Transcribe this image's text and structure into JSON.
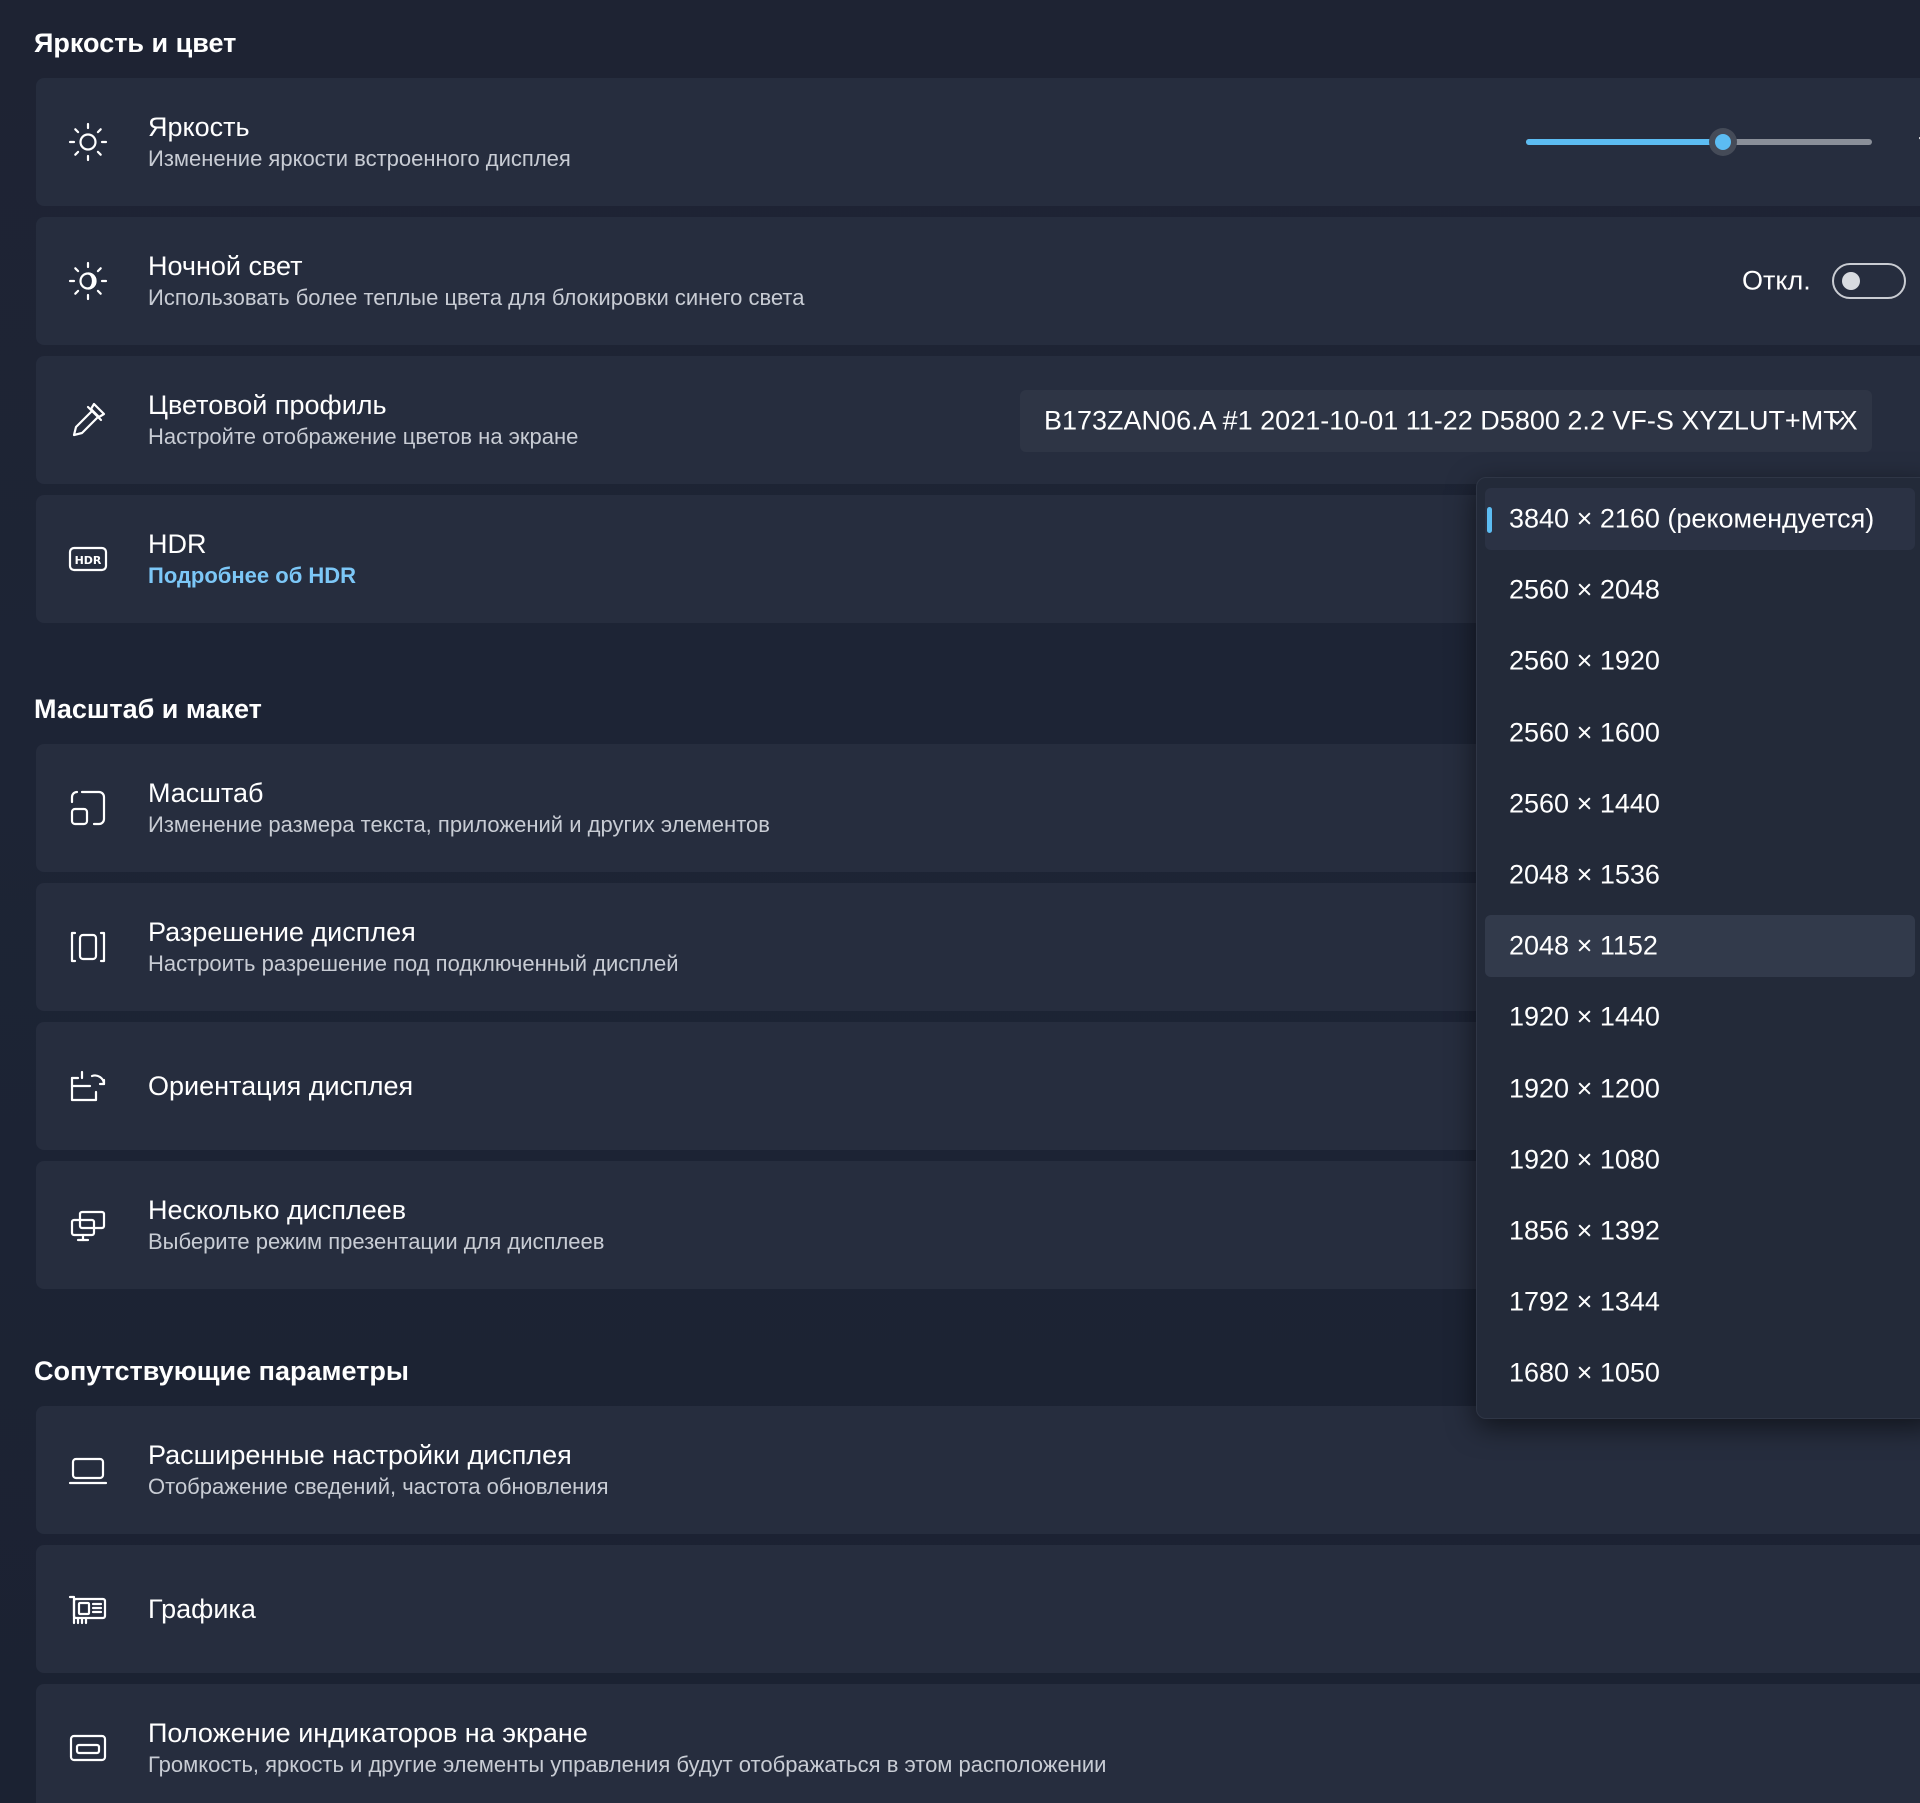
{
  "sections": {
    "brightness_color": "Яркость и цвет",
    "scale_layout": "Масштаб и макет",
    "related": "Сопутствующие параметры"
  },
  "brightness": {
    "title": "Яркость",
    "subtitle": "Изменение яркости встроенного дисплея",
    "value_fraction": 0.57,
    "icon": "sun-icon"
  },
  "night_light": {
    "title": "Ночной свет",
    "subtitle": "Использовать более теплые цвета для блокировки синего света",
    "state_label": "Откл.",
    "icon": "night-light-icon"
  },
  "color_profile": {
    "title": "Цветовой профиль",
    "subtitle": "Настройте отображение цветов на экране",
    "selected": "B173ZAN06.A #1 2021-10-01 11-22 D5800 2.2 VF-S XYZLUT+MTX",
    "icon": "eyedropper-icon"
  },
  "hdr": {
    "title": "HDR",
    "link": "Подробнее об HDR",
    "icon": "hdr-icon"
  },
  "scale": {
    "title": "Масштаб",
    "subtitle": "Изменение размера текста, приложений и других элементов",
    "icon": "scale-icon"
  },
  "resolution": {
    "title": "Разрешение дисплея",
    "subtitle": "Настроить разрешение под подключенный дисплей",
    "icon": "resolution-icon"
  },
  "orientation": {
    "title": "Ориентация дисплея",
    "icon": "orientation-icon"
  },
  "multi_display": {
    "title": "Несколько дисплеев",
    "subtitle": "Выберите режим презентации для дисплеев",
    "icon": "multi-display-icon"
  },
  "advanced_display": {
    "title": "Расширенные настройки дисплея",
    "subtitle": "Отображение сведений, частота обновления",
    "icon": "monitor-icon"
  },
  "graphics": {
    "title": "Графика",
    "icon": "graphics-card-icon"
  },
  "indicators": {
    "title": "Положение индикаторов на экране",
    "subtitle": "Громкость, яркость и другие элементы управления будут отображаться в этом расположении",
    "icon": "indicator-position-icon"
  },
  "resolution_options": [
    "3840 × 2160 (рекомендуется)",
    "2560 × 2048",
    "2560 × 1920",
    "2560 × 1600",
    "2560 × 1440",
    "2048 × 1536",
    "2048 × 1152",
    "1920 × 1440",
    "1920 × 1200",
    "1920 × 1080",
    "1856 × 1392",
    "1792 × 1344",
    "1680 × 1050"
  ],
  "resolution_selected_index": 0,
  "resolution_hover_index": 6,
  "colors": {
    "accent": "#5cbcf2",
    "card": "#262d3e",
    "background": "#1d2435"
  }
}
